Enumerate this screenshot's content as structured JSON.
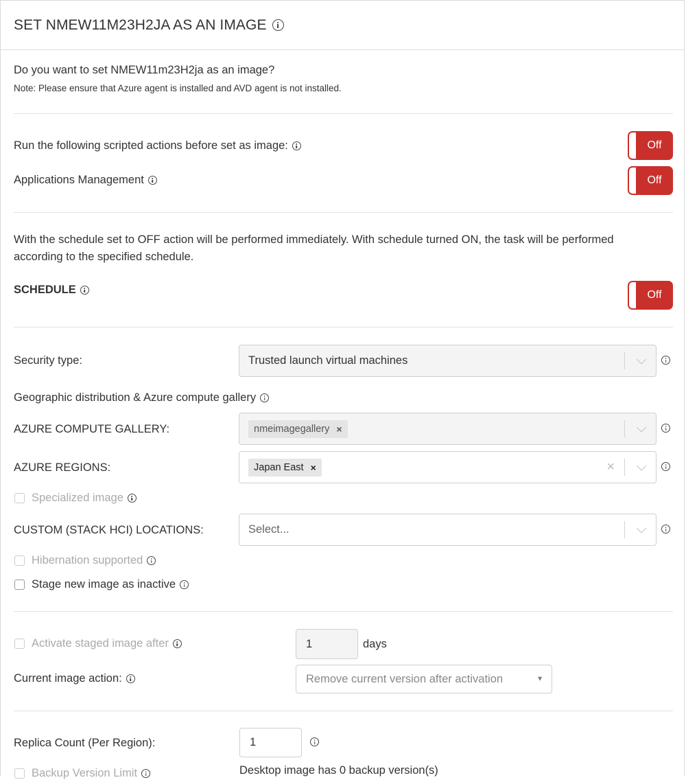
{
  "dialog": {
    "title": "SET NMEW11M23H2JA AS AN IMAGE"
  },
  "intro": {
    "question": "Do you want to set NMEW11m23H2ja as an image?",
    "note": "Note: Please ensure that Azure agent is installed and AVD agent is not installed."
  },
  "scripted_actions": {
    "label": "Run the following scripted actions before set as image:",
    "toggle": "Off"
  },
  "applications_management": {
    "label": "Applications Management",
    "toggle": "Off"
  },
  "schedule": {
    "description": "With the schedule set to OFF action will be performed immediately. With schedule turned ON, the task will be performed according to the specified schedule.",
    "label": "SCHEDULE",
    "toggle": "Off"
  },
  "security_type": {
    "label": "Security type:",
    "value": "Trusted launch virtual machines"
  },
  "geo": {
    "label": "Geographic distribution & Azure compute gallery"
  },
  "gallery": {
    "label": "AZURE COMPUTE GALLERY:",
    "tag": "nmeimagegallery"
  },
  "regions": {
    "label": "AZURE REGIONS:",
    "tag": "Japan East"
  },
  "specialized": {
    "label": "Specialized image",
    "checked": false,
    "disabled": true
  },
  "custom_locations": {
    "label": "CUSTOM (STACK HCI) LOCATIONS:",
    "placeholder": "Select..."
  },
  "hibernation": {
    "label": "Hibernation supported",
    "checked": false,
    "disabled": true
  },
  "stage_inactive": {
    "label": "Stage new image as inactive",
    "checked": false
  },
  "activate_after": {
    "label": "Activate staged image after",
    "value": "1",
    "unit": "days"
  },
  "current_action": {
    "label": "Current image action:",
    "value": "Remove current version after activation"
  },
  "replica": {
    "label": "Replica Count (Per Region):",
    "value": "1"
  },
  "backup": {
    "label": "Backup Version Limit",
    "note": "Desktop image has 0 backup version(s)"
  },
  "colors": {
    "toggle_off": "#c9302c",
    "divider": "#e2e2e2",
    "disabled_text": "#aaaaaa"
  }
}
